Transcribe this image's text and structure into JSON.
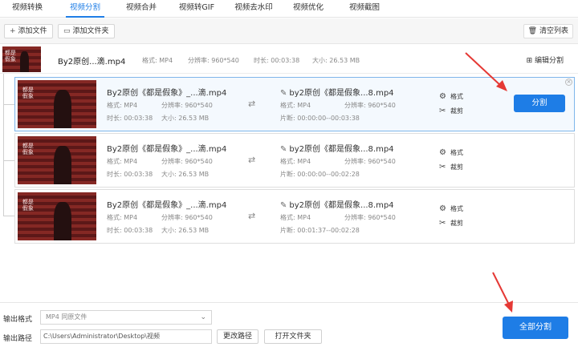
{
  "tabs": [
    "视频转换",
    "视频分割",
    "视频合并",
    "视频转GIF",
    "视频去水印",
    "视频优化",
    "视频截图"
  ],
  "active_tab": "视频分割",
  "toolbar": {
    "add_file": "添加文件",
    "add_folder": "添加文件夹",
    "clear_list": "清空列表"
  },
  "parent": {
    "thumb_text": "都是假象",
    "name": "By2原创...滴.mp4",
    "format_label": "格式: ",
    "format": "MP4",
    "res_label": "分辨率: ",
    "res": "960*540",
    "dur_label": "时长: ",
    "dur": "00:03:38",
    "size_label": "大小: ",
    "size": "26.53 MB",
    "edit_seg": "编辑分割"
  },
  "labels": {
    "format": "格式: ",
    "res": "分辨率: ",
    "dur": "时长: ",
    "size": "大小: ",
    "clip": "片断: ",
    "act_format": "格式",
    "act_cut": "裁剪",
    "split": "分割"
  },
  "segments": [
    {
      "src_title": "By2原创《都是假象》_...滴.mp4",
      "src_format": "MP4",
      "src_res": "960*540",
      "src_dur": "00:03:38",
      "src_size": "26.53 MB",
      "out_title": "by2原创《都是假象...8.mp4",
      "out_format": "MP4",
      "out_res": "960*540",
      "out_clip": "00:00:00--00:03:38"
    },
    {
      "src_title": "By2原创《都是假象》_...滴.mp4",
      "src_format": "MP4",
      "src_res": "960*540",
      "src_dur": "00:03:38",
      "src_size": "26.53 MB",
      "out_title": "by2原创《都是假象...8.mp4",
      "out_format": "MP4",
      "out_res": "960*540",
      "out_clip": "00:00:00--00:02:28"
    },
    {
      "src_title": "By2原创《都是假象》_...滴.mp4",
      "src_format": "MP4",
      "src_res": "960*540",
      "src_dur": "00:03:38",
      "src_size": "26.53 MB",
      "out_title": "by2原创《都是假象...8.mp4",
      "out_format": "MP4",
      "out_res": "960*540",
      "out_clip": "00:01:37--00:02:28"
    }
  ],
  "bottom": {
    "out_format_label": "输出格式",
    "out_format_value": "MP4  同原文件",
    "out_path_label": "输出路径",
    "out_path_value": "C:\\Users\\Administrator\\Desktop\\视频",
    "change_path": "更改路径",
    "open_folder": "打开文件夹",
    "split_all": "全部分割"
  },
  "colors": {
    "accent": "#1e7de6",
    "annotation_arrow": "#e53935"
  }
}
